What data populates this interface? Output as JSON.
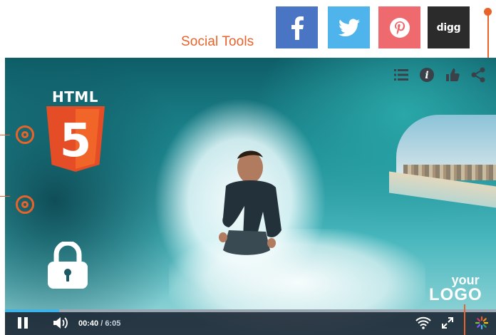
{
  "social": {
    "label": "Social Tools",
    "buttons": [
      {
        "name": "facebook",
        "glyph": "f"
      },
      {
        "name": "twitter"
      },
      {
        "name": "pinterest"
      },
      {
        "name": "digg",
        "glyph": "digg"
      }
    ]
  },
  "overlay": {
    "html5_label": "HTML",
    "html5_number": "5",
    "logo_top": "your",
    "logo_bottom": "LOGO",
    "top_icons": [
      "playlist-icon",
      "info-icon",
      "like-icon",
      "share-icon"
    ]
  },
  "player": {
    "current_time": "00:40",
    "duration": "/ 6:05",
    "progress": 0.11
  },
  "colors": {
    "accent": "#e8632a",
    "progress": "#3db3e8",
    "facebook": "#4a75c4",
    "twitter": "#4fb4ec",
    "pinterest": "#ef6a6f",
    "digg": "#2b2b2b"
  }
}
